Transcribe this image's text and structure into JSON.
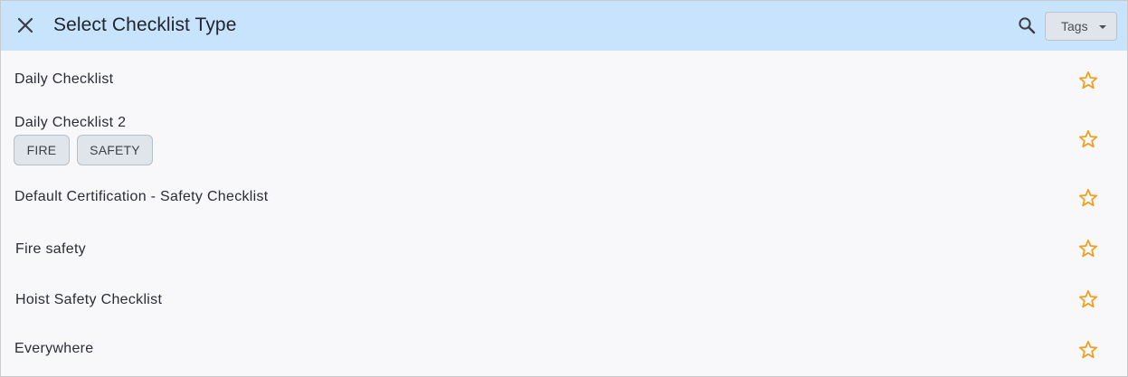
{
  "header": {
    "title": "Select Checklist Type",
    "close_icon": "close-icon",
    "search_icon": "search-icon",
    "tags_label": "Tags"
  },
  "colors": {
    "header_bg": "#c8e4fd",
    "star": "#f0a020",
    "chip_bg": "#dfe5ea"
  },
  "checklists": [
    {
      "label": "Daily Checklist",
      "tags": [],
      "favorite": false
    },
    {
      "label": "Daily Checklist 2",
      "tags": [
        "FIRE",
        "SAFETY"
      ],
      "favorite": false
    },
    {
      "label": "Default Certification - Safety Checklist",
      "tags": [],
      "favorite": false
    },
    {
      "label": "Fire safety",
      "tags": [],
      "favorite": false
    },
    {
      "label": "Hoist Safety Checklist",
      "tags": [],
      "favorite": false
    },
    {
      "label": "Everywhere",
      "tags": [],
      "favorite": false
    }
  ]
}
